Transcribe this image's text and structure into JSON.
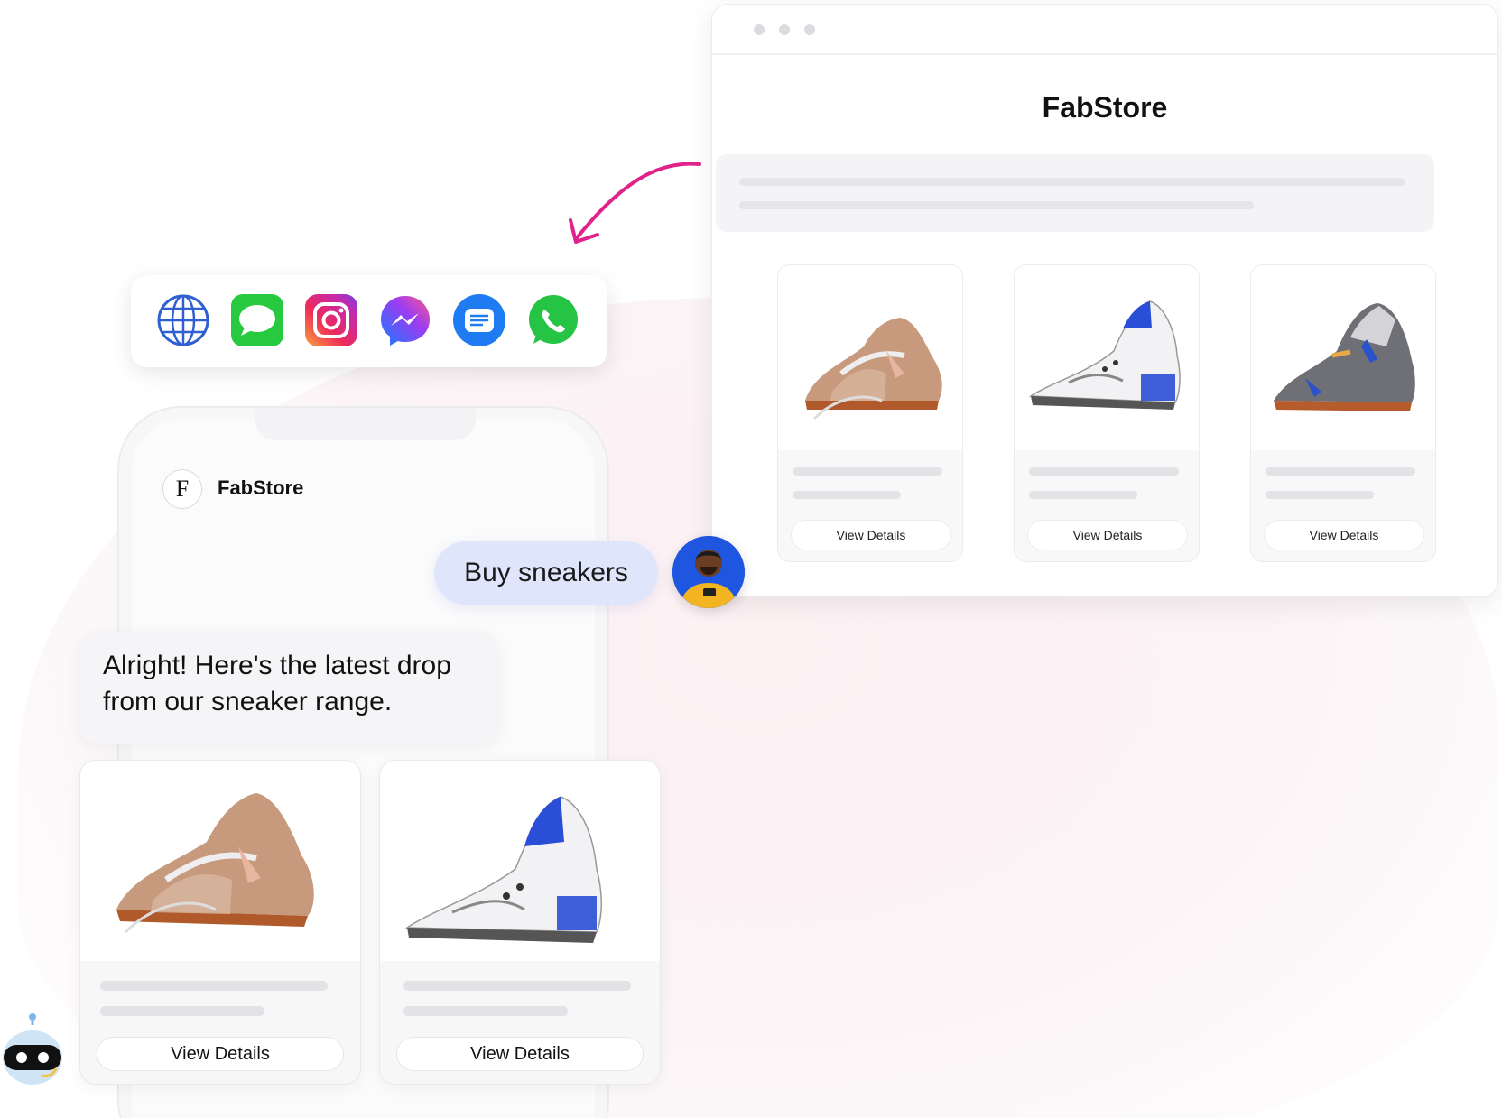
{
  "browser": {
    "title": "FabStore",
    "products": [
      {
        "button_label": "View Details",
        "shoe": "beige"
      },
      {
        "button_label": "View Details",
        "shoe": "white-blue"
      },
      {
        "button_label": "View Details",
        "shoe": "grey-blue"
      }
    ]
  },
  "channels": [
    {
      "icon": "globe-icon"
    },
    {
      "icon": "imessage-icon"
    },
    {
      "icon": "instagram-icon"
    },
    {
      "icon": "messenger-icon"
    },
    {
      "icon": "sms-icon"
    },
    {
      "icon": "whatsapp-icon"
    }
  ],
  "phone": {
    "avatar_letter": "F",
    "brand": "FabStore"
  },
  "chat": {
    "user_message": "Buy sneakers",
    "bot_message_line1": "Alright! Here's the latest drop",
    "bot_message_line2": "from our sneaker range.",
    "products": [
      {
        "button_label": "View Details",
        "shoe": "beige"
      },
      {
        "button_label": "View Details",
        "shoe": "white-blue"
      }
    ]
  },
  "colors": {
    "accent_arrow": "#e0238a",
    "user_bubble": "#dfe6fb",
    "whatsapp": "#25c444",
    "imessage": "#27c93f",
    "sms": "#1f7bf2"
  }
}
